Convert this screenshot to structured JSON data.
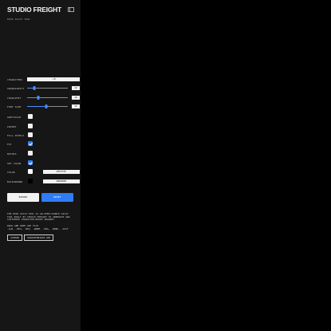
{
  "brand": {
    "title": "STUDIO FREIGHT"
  },
  "subtitle": "ROSE ASCII TOOL",
  "controls": {
    "characters": {
      "label": "CHARACTERS",
      "value": "./0"
    },
    "granularity": {
      "label": "GRANULARITY",
      "value": "12",
      "level": 0.18
    },
    "charlimit": {
      "label": "CHARLIMIT",
      "value": "16",
      "level": 0.28
    },
    "fontsize": {
      "label": "FONT SIZE",
      "value": "32",
      "level": 0.48
    },
    "greyscale": {
      "label": "GREYSCALE",
      "checked": false
    },
    "invert": {
      "label": "INVERT",
      "checked": false
    },
    "fill_pixels": {
      "label": "FILL PIXELS",
      "checked": false
    },
    "fit": {
      "label": "FIT",
      "checked": true
    },
    "matrix": {
      "label": "MATRIX",
      "checked": false
    },
    "set_color": {
      "label": "SET COLOR",
      "checked": true
    },
    "color": {
      "label": "COLOR",
      "value": "#FFFFFF",
      "swatch": "#FFFFFF"
    },
    "background": {
      "label": "BACKGROUND",
      "value": "#000000",
      "swatch": "#000000"
    }
  },
  "actions": {
    "export": "EXPORT",
    "reset": "RESET"
  },
  "description": {
    "line1": "THE ROSE ASCII TOOL IS AN OPEN-SOURCE ASCII",
    "line2": "TOOL BUILT BY STUDIO FREIGHT TO GENERATE AND",
    "line3": "CUSTOMIZE CHARACTER-BASED IMAGERY."
  },
  "dropzone": {
    "line1": "DRAG AND DROP ANY FILE",
    "line2": ".GLB, .MP4, .MOV, .WEBM, .PNG, .WEBP, .AVIF"
  },
  "links": {
    "github": "GITHUB",
    "website": "STUDIOFREIGHT.COM"
  },
  "colors": {
    "accent": "#2F7CF6",
    "panel": "#161616",
    "canvas": "#000000"
  }
}
